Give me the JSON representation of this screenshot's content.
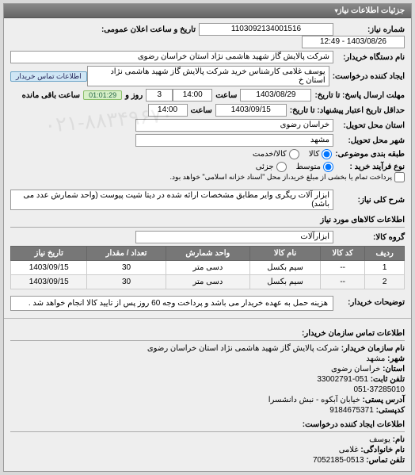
{
  "panel_title": "جزئیات اطلاعات نیاز",
  "labels": {
    "need_no": "شماره نیاز:",
    "announce_dt": "تاریخ و ساعت اعلان عمومی:",
    "buyer_org": "نام دستگاه خریدار:",
    "requester": "ایجاد کننده درخواست:",
    "buyer_contact_tag": "اطلاعات تماس خریدار",
    "respond_until": "مهلت ارسال پاسخ: تا تاریخ:",
    "time": "ساعت",
    "days": "روز و",
    "remaining": "ساعت باقی مانده",
    "valid_until": "حداقل تاریخ اعتبار پیشنهاد: تا تاریخ:",
    "delivery_prov": "استان محل تحویل:",
    "delivery_city": "شهر محل تحویل:",
    "pkg_type": "طبقه بندی موضوعی:",
    "kala": "کالا",
    "khadamat": "کالا/خدمت",
    "buy_type": "نوع فرآیند خرید :",
    "mid": "متوسط",
    "partial": "جزئی",
    "pay_note": "پرداخت تمام یا بخشی از مبلغ خرید،از محل \"اسناد خزانه اسلامی\" خواهد بود.",
    "overall_desc_lbl": "شرح کلی نیاز:",
    "goods_info": "اطلاعات کالاهای مورد نیاز",
    "goods_group": "گروه کالا:",
    "buyer_notes_lbl": "توضیحات خریدار:",
    "contact_header": "اطلاعات تماس سازمان خریدار:",
    "org_name": "نام سازمان خریدار:",
    "city": "شهر:",
    "province": "استان:",
    "phone": "تلفن ثابت:",
    "address": "آدرس پستی:",
    "postcode": "کدپستی:",
    "requester_header": "اطلاعات ایجاد کننده درخواست:",
    "fname": "نام:",
    "lname": "نام خانوادگی:",
    "mobile": "تلفن تماس:"
  },
  "values": {
    "need_no": "1103092134001516",
    "announce_dt": "1403/08/26 - 12:49",
    "buyer_org": "شرکت پالایش گاز شهید هاشمی نژاد    استان خراسان رضوی",
    "requester": "یوسف غلامی کارشناس خرید شرکت پالایش گاز شهید هاشمی نژاد    استان خ",
    "respond_date": "1403/08/29",
    "respond_time": "14:00",
    "days_left": "3",
    "time_left": "01:01:29",
    "valid_date": "1403/09/15",
    "valid_time": "14:00",
    "delivery_prov": "خراسان رضوی",
    "delivery_city": "مشهد",
    "overall_desc": "ابزار آلات ریگری وایر مطابق مشخصات ارائه شده در دیتا شیت پیوست (واحد شمارش عدد می باشد)",
    "goods_group": "ابزارآلات",
    "buyer_notes": "هزینه حمل به عهده خریدار می باشد و پرداخت وجه 60 روز پس از تایید کالا انجام خواهد شد .",
    "org_name_v": "شرکت پالایش گاز شهید هاشمی نژاد استان خراسان رضوی",
    "city_v": "مشهد",
    "province_v": "خراسان رضوی",
    "phone_v": "051-33002791",
    "phone2_v": "051-37285010",
    "address_v": "خیابان آبکوه - نبش دانشسرا",
    "postcode_v": "9184675371",
    "fname_v": "یوسف",
    "lname_v": "غلامی",
    "mobile_v": "0513-7052185"
  },
  "table": {
    "headers": [
      "ردیف",
      "کد کالا",
      "نام کالا",
      "واحد شمارش",
      "تعداد / مقدار",
      "تاریخ نیاز"
    ],
    "rows": [
      [
        "1",
        "--",
        "سیم بکسل",
        "دسی متر",
        "30",
        "1403/09/15"
      ],
      [
        "2",
        "--",
        "سیم بکسل",
        "دسی متر",
        "30",
        "1403/09/15"
      ]
    ]
  }
}
